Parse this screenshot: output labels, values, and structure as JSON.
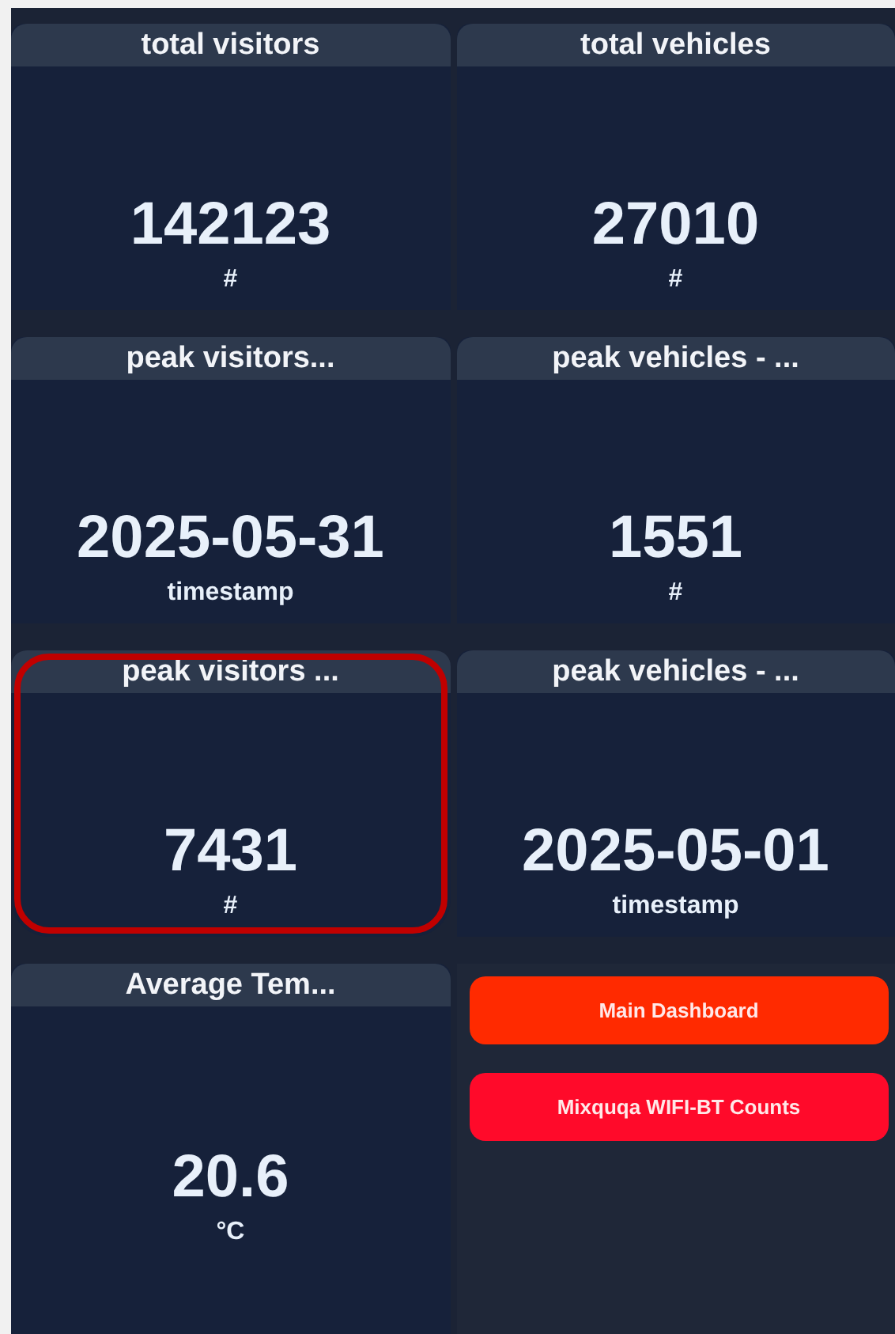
{
  "left_column": {
    "cards": [
      {
        "title": "total visitors",
        "value": "142123",
        "unit": "#",
        "highlighted": false
      },
      {
        "title": "peak visitors...",
        "value": "2025-05-31",
        "unit": "timestamp",
        "highlighted": false
      },
      {
        "title": "peak visitors ...",
        "value": "7431",
        "unit": "#",
        "highlighted": true
      },
      {
        "title": "Average Tem...",
        "value": "20.6",
        "unit": "°C",
        "highlighted": false
      }
    ]
  },
  "right_column": {
    "cards": [
      {
        "title": "total vehicles",
        "value": "27010",
        "unit": "#",
        "highlighted": false
      },
      {
        "title": "peak vehicles - ...",
        "value": "1551",
        "unit": "#",
        "highlighted": false
      },
      {
        "title": "peak vehicles - ...",
        "value": "2025-05-01",
        "unit": "timestamp",
        "highlighted": false
      }
    ],
    "buttons": [
      {
        "label": "Main Dashboard",
        "color": "#ff2a00"
      },
      {
        "label": "Mixquqa WIFI-BT Counts",
        "color": "#ff0a2a"
      }
    ]
  }
}
